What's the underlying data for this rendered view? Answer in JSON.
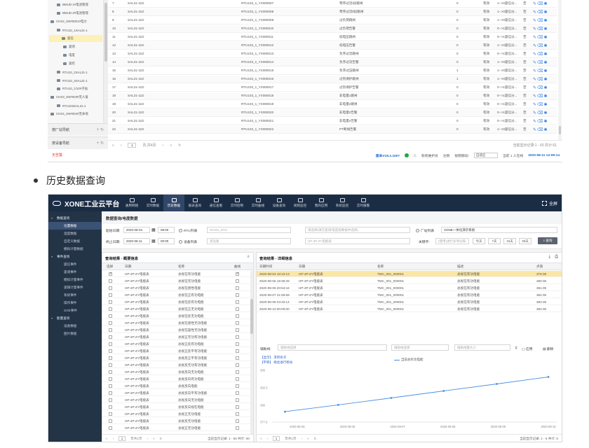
{
  "top_screenshot": {
    "tree_nodes": [
      {
        "label": "BMUD-1#电池管理",
        "indent": 1
      },
      {
        "label": "BMUD-2#电池管理",
        "indent": 1
      },
      {
        "label": "CHS2_SN#0001#电力",
        "indent": 0
      },
      {
        "label": "RTU10_1SAL31-1",
        "indent": 1
      },
      {
        "label": "遥信",
        "indent": 2,
        "selected": true
      },
      {
        "label": "遥测",
        "indent": 2
      },
      {
        "label": "电度",
        "indent": 2
      },
      {
        "label": "遥控",
        "indent": 2
      },
      {
        "label": "RTU10_2SAL31-1",
        "indent": 1
      },
      {
        "label": "RTU10_3SAL31-1",
        "indent": 1
      },
      {
        "label": "RTU10_1/10#子站",
        "indent": 1
      },
      {
        "label": "CHS3_SN#003#无人值",
        "indent": 0
      },
      {
        "label": "RTU103SAL31-1",
        "indent": 1
      },
      {
        "label": "CHS4_SN#004#无本地",
        "indent": 0
      }
    ],
    "nav_panels": [
      {
        "label": "按厂站导航",
        "controls": "+ ↻"
      },
      {
        "label": "按设备导航",
        "controls": "+ ↻"
      }
    ],
    "alarm_label": "无告警",
    "rows": [
      {
        "no": "7",
        "dev": "SAL31-11D",
        "addr": "RTU103_1_YX000007",
        "name": "零序过流Ⅰ段跳闸",
        "val": "0",
        "valid": "有效",
        "type": "1-->0遥信分...",
        "flag": "否"
      },
      {
        "no": "8",
        "dev": "SAL31-11D",
        "addr": "RTU103_1_YX000008",
        "name": "零序过流Ⅱ段跳闸",
        "val": "0",
        "valid": "有效",
        "type": "1-->0遥信分...",
        "flag": "否"
      },
      {
        "no": "9",
        "dev": "SAL31-11D",
        "addr": "RTU103_1_YX000009",
        "name": "过负荷跳闸",
        "val": "0",
        "valid": "有效",
        "type": "1-->0遥信分...",
        "flag": "否"
      },
      {
        "no": "10",
        "dev": "SAL31-11D",
        "addr": "RTU103_1_YX000010",
        "name": "过负荷告警",
        "val": "0",
        "valid": "有效",
        "type": "0-->1遥信分...",
        "flag": "否"
      },
      {
        "no": "11",
        "dev": "SAL31-11D",
        "addr": "RTU103_1_YX000011",
        "name": "低电压跳闸",
        "val": "0",
        "valid": "有效",
        "type": "0-->1遥信分...",
        "flag": "否"
      },
      {
        "no": "12",
        "dev": "SAL31-11D",
        "addr": "RTU103_1_YX000012",
        "name": "低电压告警",
        "val": "0",
        "valid": "有效",
        "type": "1-->0遥信分...",
        "flag": "否"
      },
      {
        "no": "13",
        "dev": "SAL31-11D",
        "addr": "RTU103_1_YX000013",
        "name": "负序过流跳闸",
        "val": "0",
        "valid": "有效",
        "type": "0-->1遥信分...",
        "flag": "否"
      },
      {
        "no": "14",
        "dev": "SAL31-11D",
        "addr": "RTU103_1_YX000014",
        "name": "负序过流告警",
        "val": "0",
        "valid": "有效",
        "type": "1-->0遥信分...",
        "flag": "否"
      },
      {
        "no": "15",
        "dev": "SAL31-11D",
        "addr": "RTU103_1_YX000015",
        "name": "负序过压跳闸",
        "val": "1",
        "valid": "有效",
        "type": "1-->0遥信分...",
        "flag": "否"
      },
      {
        "no": "16",
        "dev": "SAL31-11D",
        "addr": "RTU103_1_YX000016",
        "name": "过热保护跳闸",
        "val": "1",
        "valid": "有效",
        "type": "1-->0遥信分...",
        "flag": "否"
      },
      {
        "no": "17",
        "dev": "SAL31-11D",
        "addr": "RTU103_1_YX000017",
        "name": "过热保护告警",
        "val": "0",
        "valid": "有效",
        "type": "0-->1遥信分...",
        "flag": "否"
      },
      {
        "no": "18",
        "dev": "SAL31-11D",
        "addr": "RTU103_1_YX000018",
        "name": "非电量1跳闸",
        "val": "0",
        "valid": "有效",
        "type": "0-->1遥信分...",
        "flag": "否"
      },
      {
        "no": "19",
        "dev": "SAL31-11D",
        "addr": "RTU103_1_YX000019",
        "name": "非电量2跳闸",
        "val": "0",
        "valid": "有效",
        "type": "0-->1遥信分...",
        "flag": "否"
      },
      {
        "no": "20",
        "dev": "SAL31-11D",
        "addr": "RTU103_1_YX000020",
        "name": "非电量3告警",
        "val": "0",
        "valid": "有效",
        "type": "0-->1遥信分...",
        "flag": "否"
      },
      {
        "no": "21",
        "dev": "SAL31-11D",
        "addr": "RTU103_1_YX000021",
        "name": "非电量4告警",
        "val": "0",
        "valid": "有效",
        "type": "0-->1遥信分...",
        "flag": "否"
      },
      {
        "no": "22",
        "dev": "SAL31-11D",
        "addr": "RTU103_1_YX000022",
        "name": "PT断线告警",
        "val": "0",
        "valid": "有效",
        "type": "1-->0遥信分...",
        "flag": "否"
      }
    ],
    "pager": {
      "first": "«",
      "prev": "‹",
      "page": "1",
      "of": "页,共4页",
      "next": "›",
      "last": "»",
      "refresh": "↻",
      "summary": "当前显示记录:1 - 60 共计:61"
    },
    "status": {
      "version": "版本V19.2.1007",
      "maint": "系统维护员",
      "logout": "注销",
      "theme_label": "视频随动:",
      "theme_value": "自适应",
      "online": "当前 1 人在线",
      "datetime": "2020-08-11 12:09:14"
    }
  },
  "bullet_text": "历史数据查询",
  "app": {
    "title": "XONE工业云平台",
    "fullscreen": "全屏",
    "nav": [
      "通用网络",
      "实时数据",
      "历史数据",
      "报表查询",
      "通信查看",
      "实时控制",
      "实时曲线",
      "设备查询",
      "视频监控",
      "我的应用",
      "系统监控",
      "实时报警"
    ],
    "active_nav": 2,
    "sidebar": [
      {
        "label": "数据查询",
        "type": "group"
      },
      {
        "label": "位置数据",
        "type": "sub",
        "active": true
      },
      {
        "label": "温度数据",
        "type": "sub"
      },
      {
        "label": "自定义数据",
        "type": "sub"
      },
      {
        "label": "模拟计量数据",
        "type": "sub"
      },
      {
        "label": "事件查询",
        "type": "group"
      },
      {
        "label": "遥信事件",
        "type": "sub"
      },
      {
        "label": "遥测事件",
        "type": "sub"
      },
      {
        "label": "模拟计量事件",
        "type": "sub"
      },
      {
        "label": "逻辑计量事件",
        "type": "sub"
      },
      {
        "label": "系统事件",
        "type": "sub"
      },
      {
        "label": "操作事件",
        "type": "sub"
      },
      {
        "label": "SOE事件",
        "type": "sub"
      },
      {
        "label": "能量查询",
        "type": "group"
      },
      {
        "label": "设备数据",
        "type": "sub"
      },
      {
        "label": "图片数据",
        "type": "sub"
      }
    ],
    "crumb": "数据查询/电度数据",
    "filter": {
      "start_label": "起始日期:",
      "start_date": "2020-08-04",
      "start_time": "08:00",
      "end_label": "终止日期:",
      "end_date": "2020-08-11",
      "end_time": "00:00",
      "radio_rtu": "RTU列表",
      "radio_dev": "设备列表",
      "rtu_ph": "SHJ01_RTU",
      "dev_ph": "某设备",
      "mid_ph1": "请选择(请在遥测/电度类数据中选择)",
      "mid_ph2": "HP-4P-ZY电能表",
      "plant_label": "厂站列表",
      "plant_value": "XONE一体化演示系统",
      "keyword_label": "关键字:",
      "keyword_ph": "(使用)进行多项分隔",
      "quick": [
        "今天",
        "7天",
        "15天",
        "30天"
      ],
      "search_btn": "查询"
    },
    "left_panel": {
      "title": "查询结果 - 概要信息",
      "cols": [
        "选择",
        "日期",
        "名称",
        "曲线"
      ],
      "rows": [
        {
          "date": "HP-4P-ZY电能表",
          "name": "总视在有功电能",
          "sel": true,
          "curve": true
        },
        {
          "date": "HP-4P-ZY电能表",
          "name": "总视在无功电能",
          "sel": false,
          "curve": false
        },
        {
          "date": "HP-4P-ZY电能表",
          "name": "总视在感性电能",
          "sel": false,
          "curve": false
        },
        {
          "date": "HP-4P-ZY电能表",
          "name": "总视在正有功电能",
          "sel": false,
          "curve": false
        },
        {
          "date": "HP-4P-ZY电能表",
          "name": "总视在反有功电能",
          "sel": false,
          "curve": false
        },
        {
          "date": "HP-4P-ZY电能表",
          "name": "总视在正无功电能",
          "sel": false,
          "curve": false
        },
        {
          "date": "HP-4P-ZY电能表",
          "name": "总视在反无功电能",
          "sel": false,
          "curve": false
        },
        {
          "date": "HP-4P-ZY电能表",
          "name": "总视在感性无功电能",
          "sel": false,
          "curve": false
        },
        {
          "date": "HP-4P-ZY电能表",
          "name": "总视在容性无功电能",
          "sel": false,
          "curve": false
        },
        {
          "date": "HP-4P-ZY电能表",
          "name": "总视正无功有功电能",
          "sel": false,
          "curve": false
        },
        {
          "date": "HP-4P-ZY电能表",
          "name": "总视正反有功电能",
          "sel": false,
          "curve": false
        },
        {
          "date": "HP-4P-ZY电能表",
          "name": "总视正反平有功电能",
          "sel": false,
          "curve": false
        },
        {
          "date": "HP-4P-ZY电能表",
          "name": "总视反正平有功电能",
          "sel": false,
          "curve": false
        },
        {
          "date": "HP-4P-ZY电能表",
          "name": "总视反无功有功电能",
          "sel": false,
          "curve": false
        },
        {
          "date": "HP-4P-ZY电能表",
          "name": "总视反向无功电能",
          "sel": false,
          "curve": false
        },
        {
          "date": "HP-4P-ZY电能表",
          "name": "总视反向有功电能",
          "sel": false,
          "curve": false
        },
        {
          "date": "HP-4P-ZY电能表",
          "name": "总视反向电能",
          "sel": false,
          "curve": false
        },
        {
          "date": "HP-4P-ZY电能表",
          "name": "总视反向平有功电能",
          "sel": false,
          "curve": false
        },
        {
          "date": "HP-4P-ZY电能表",
          "name": "总视反向无功电能",
          "sel": false,
          "curve": false
        },
        {
          "date": "HP-4P-ZY电能表",
          "name": "总视反向视在电能",
          "sel": false,
          "curve": false
        },
        {
          "date": "HP-4P-ZY电能表",
          "name": "总视正无功电能",
          "sel": false,
          "curve": false
        },
        {
          "date": "HP-4P-ZY电能表",
          "name": "总视反无功电能",
          "sel": false,
          "curve": false
        },
        {
          "date": "HP-4P-ZY电能表",
          "name": "总视正无功电能",
          "sel": false,
          "curve": false
        }
      ],
      "pager": {
        "first": "«",
        "prev": "‹",
        "page": "1",
        "of": "页共1页",
        "next": "›",
        "last": "»",
        "refresh": "↻",
        "summary": "当前显示记录: 1 - 60 共计: 60"
      }
    },
    "right_panel": {
      "title": "查询结果 - 详细信息",
      "cols": [
        "日期时间",
        "日期",
        "名称",
        "描述",
        "点值"
      ],
      "rows": [
        {
          "dt": "2020-08-04 18:10:13",
          "dev": "HP-4P-ZY电能表",
          "name": "TMC_001_000001",
          "desc": "总视在有功电能",
          "val": "379.09",
          "hl": true
        },
        {
          "dt": "2020-08-05 19:36:29",
          "dev": "HP-4P-ZY电能表",
          "name": "TMC_001_000001",
          "desc": "总视在有功电能",
          "val": "380.06",
          "hl": false
        },
        {
          "dt": "2020-08-06 20:54:44",
          "dev": "HP-4P-ZY电能表",
          "name": "TMC_001_000001",
          "desc": "总视在有功电能",
          "val": "381.05",
          "hl": false
        },
        {
          "dt": "2020-08-07 21:59:59",
          "dev": "HP-4P-ZY电能表",
          "name": "TMC_001_000001",
          "desc": "总视在有功电能",
          "val": "382.05",
          "hl": false
        },
        {
          "dt": "2020-08-08 23:20:14",
          "dev": "HP-4P-ZY电能表",
          "name": "TMC_001_000001",
          "desc": "总视在有功电能",
          "val": "383.05",
          "hl": false
        },
        {
          "dt": "2020-08-10 00:00:00",
          "dev": "HP-4P-ZY电能表",
          "name": "TMC_001_000001",
          "desc": "总视在有功电能",
          "val": "384.05",
          "hl": false
        }
      ],
      "pager": {
        "first": "«",
        "prev": "‹",
        "page": "1",
        "of": "页共1页",
        "next": "›",
        "last": "»",
        "refresh": "↻",
        "summary": "当前显示记录: 1 - 6 共计: 6"
      },
      "chart_controls": {
        "aux_label": "辅助线:",
        "sel1_ph": "辅助线选择",
        "sel2_ph": "辅助线最大小",
        "apply": "应用",
        "delete": "删除"
      },
      "legend_note1": "【显示】 求所有点",
      "legend_note2": "【平移】 拖住进行移动"
    }
  },
  "chart_data": {
    "type": "line",
    "series": [
      {
        "name": "当前总有功电能",
        "x": [
          "2020-08-04 18:10:13",
          "2020-08-05 19:36:29",
          "2020-08-06 20:54:44",
          "2020-08-07 21:59:59",
          "2020-08-08 23:20:14",
          "2020-08-10 00:00:00"
        ],
        "values": [
          379.09,
          380.06,
          381.05,
          382.05,
          383.05,
          384.05
        ]
      }
    ],
    "x_ticks": [
      "2020-08-05",
      "2020-08-06",
      "2020-08-07",
      "2020-08-08",
      "2020-08-09",
      "2020-08-10"
    ],
    "y_ticks": [
      "377.6",
      "380",
      "382.5",
      "385"
    ],
    "ylim": [
      377.6,
      385
    ],
    "grid": false,
    "legend": "top-center",
    "colors": {
      "line": "#4a90e2"
    }
  }
}
